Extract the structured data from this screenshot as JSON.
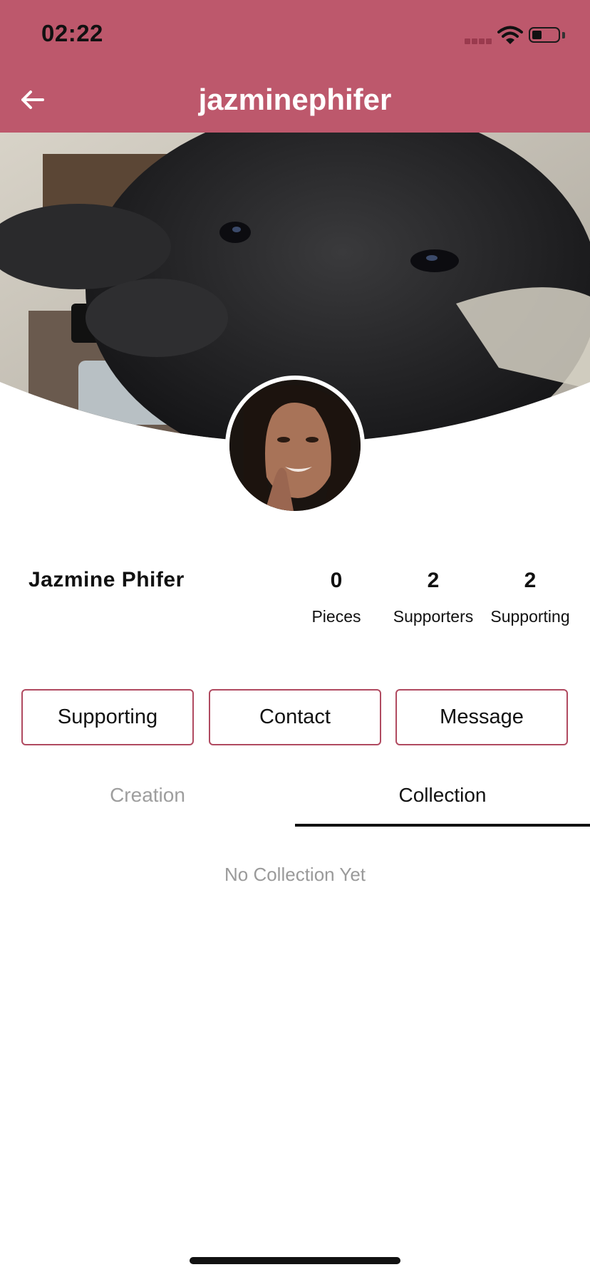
{
  "status_bar": {
    "time": "02:22"
  },
  "header": {
    "title": "jazminephifer",
    "back_icon": "arrow-left-icon",
    "background": "#bd586c"
  },
  "profile": {
    "display_name": "Jazmine  Phifer",
    "stats": [
      {
        "value": "0",
        "label": "Pieces"
      },
      {
        "value": "2",
        "label": "Supporters"
      },
      {
        "value": "2",
        "label": "Supporting"
      }
    ]
  },
  "actions": {
    "supporting": "Supporting",
    "contact": "Contact",
    "message": "Message",
    "border_color": "#b04a60"
  },
  "tabs": {
    "creation": "Creation",
    "collection": "Collection",
    "active": "Collection"
  },
  "content": {
    "empty_text": "No Collection Yet"
  }
}
